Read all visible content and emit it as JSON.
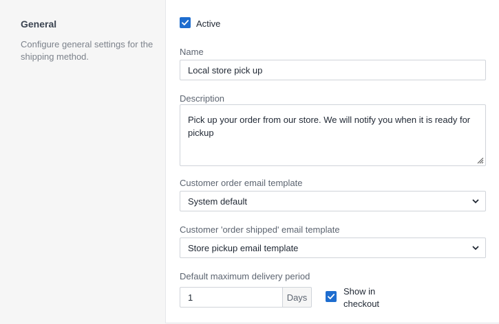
{
  "section": {
    "title": "General",
    "description": "Configure general settings for the shipping method."
  },
  "active": {
    "label": "Active",
    "checked": true
  },
  "name": {
    "label": "Name",
    "value": "Local store pick up"
  },
  "description": {
    "label": "Description",
    "value": "Pick up your order from our store. We will notify you when it is ready for pickup"
  },
  "order_email": {
    "label": "Customer order email template",
    "selected": "System default"
  },
  "shipped_email": {
    "label": "Customer 'order shipped' email template",
    "selected": "Store pickup email template"
  },
  "delivery": {
    "label": "Default maximum delivery period",
    "value": "1",
    "unit": "Days",
    "show_in_checkout_label": "Show in checkout",
    "show_in_checkout_checked": true
  },
  "colors": {
    "accent": "#1e6dcf",
    "border": "#cfd3d9",
    "muted": "#7c828b"
  }
}
